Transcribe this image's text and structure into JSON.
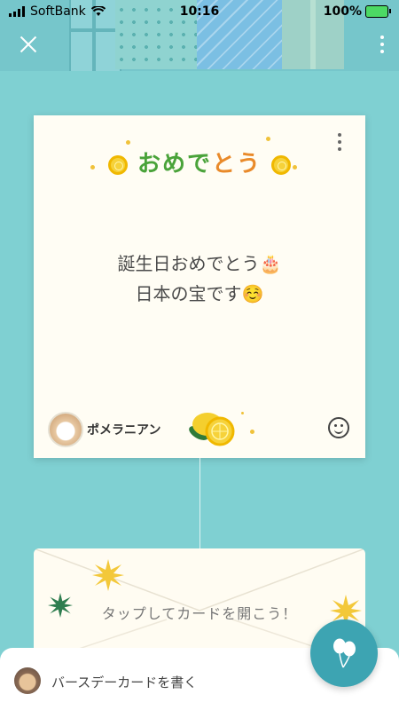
{
  "status_bar": {
    "carrier": "SoftBank",
    "time": "10:16",
    "battery": "100%"
  },
  "header": {
    "close_icon": "close-icon",
    "more_icon": "more-vertical-icon"
  },
  "card": {
    "title_part1": "おめで",
    "title_part2": "とう",
    "message_line1": "誕生日おめでとう🎂",
    "message_line2": "日本の宝です☺️",
    "sender_name": "ポメラニアン",
    "reaction_icon": "smiley-icon"
  },
  "envelope": {
    "prompt": "タップしてカードを開こう！"
  },
  "bottom_bar": {
    "label": "バースデーカードを書く"
  },
  "fab": {
    "icon": "balloons-icon"
  },
  "colors": {
    "background": "#7fd0d2",
    "fab": "#3da4b2",
    "title_green": "#4aa33a",
    "title_orange": "#e98a2a"
  }
}
